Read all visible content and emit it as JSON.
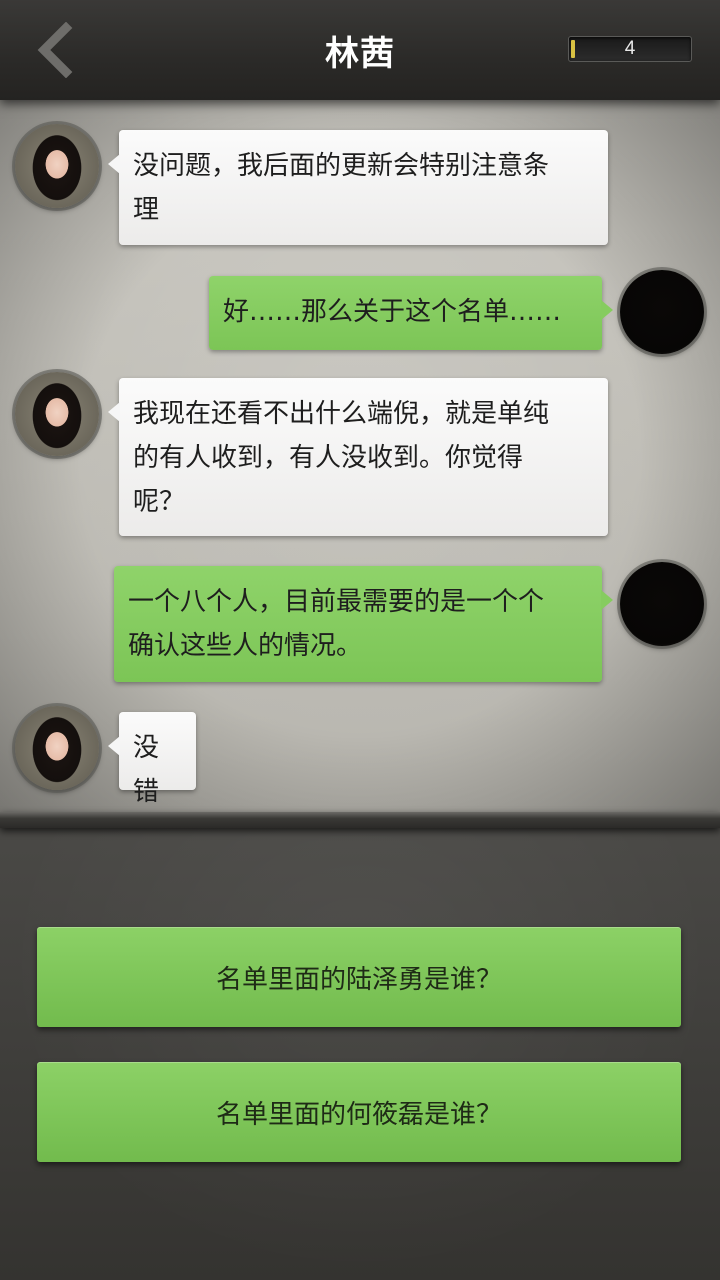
{
  "header": {
    "title": "林茜",
    "back_icon": "chevron-left-icon",
    "counter_value": "4"
  },
  "messages": [
    {
      "sender": "contact",
      "text_lines": [
        "没问题，我后面的更新会特别注意条",
        "理"
      ]
    },
    {
      "sender": "self",
      "text_lines": [
        "好……那么关于这个名单……"
      ]
    },
    {
      "sender": "contact",
      "text_lines": [
        "我现在还看不出什么端倪，就是单纯",
        "的有人收到，有人没收到。你觉得",
        "呢？"
      ]
    },
    {
      "sender": "self",
      "text_lines": [
        "一个八个人，目前最需要的是一个个",
        "确认这些人的情况。"
      ]
    },
    {
      "sender": "contact",
      "text_lines": [
        "没错"
      ]
    }
  ],
  "choices": [
    {
      "label": "名单里面的陆泽勇是谁？"
    },
    {
      "label": "名单里面的何筱磊是谁？"
    }
  ],
  "colors": {
    "accent_green": "#7cc556",
    "bubble_white": "#f6f6f6",
    "header_bg": "#2b2a28"
  }
}
